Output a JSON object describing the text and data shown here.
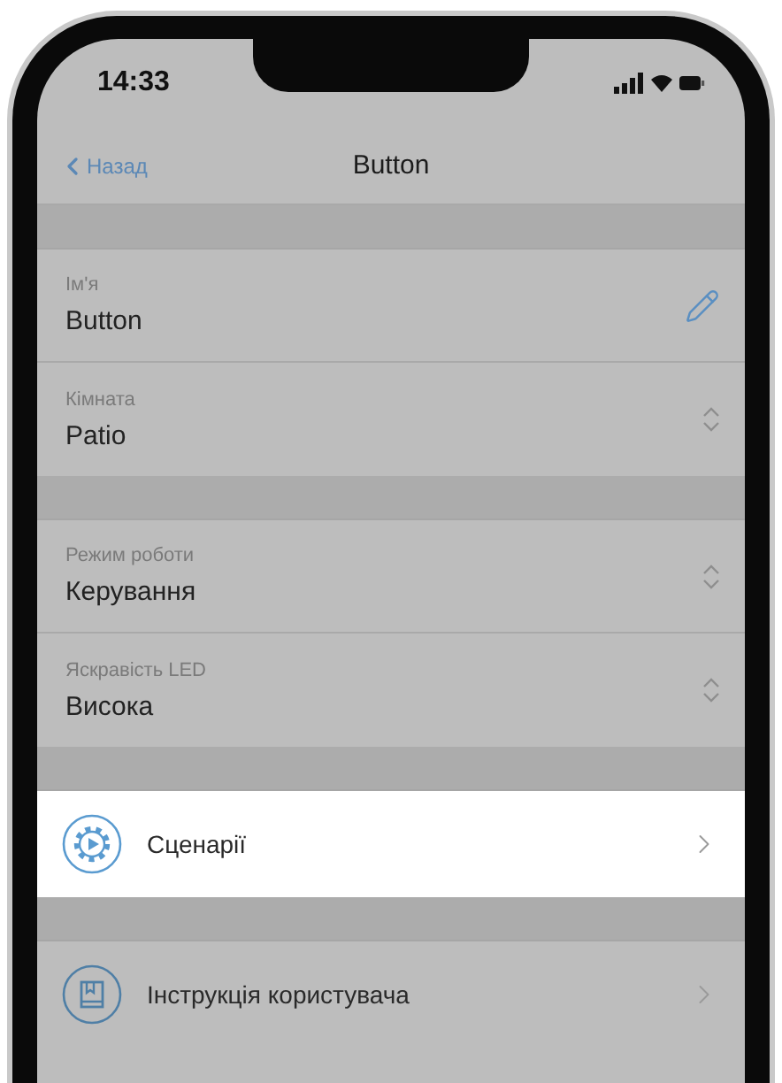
{
  "status_bar": {
    "time": "14:33"
  },
  "nav_bar": {
    "back": "Назад",
    "title": "Button"
  },
  "sections": [
    {
      "items": [
        {
          "kind": "edit",
          "label": "Ім'я",
          "value": "Button"
        },
        {
          "kind": "picker",
          "label": "Кімната",
          "value": "Patio"
        }
      ]
    },
    {
      "items": [
        {
          "kind": "picker",
          "label": "Режим роботи",
          "value": "Керування"
        },
        {
          "kind": "picker",
          "label": "Яскравість LED",
          "value": "Висока"
        }
      ]
    },
    {
      "items": [
        {
          "kind": "scenarios",
          "label": "Сценарії",
          "highlighted": true
        }
      ]
    },
    {
      "items": [
        {
          "kind": "manual",
          "label": "Інструкція користувача",
          "highlighted": false
        }
      ]
    }
  ]
}
